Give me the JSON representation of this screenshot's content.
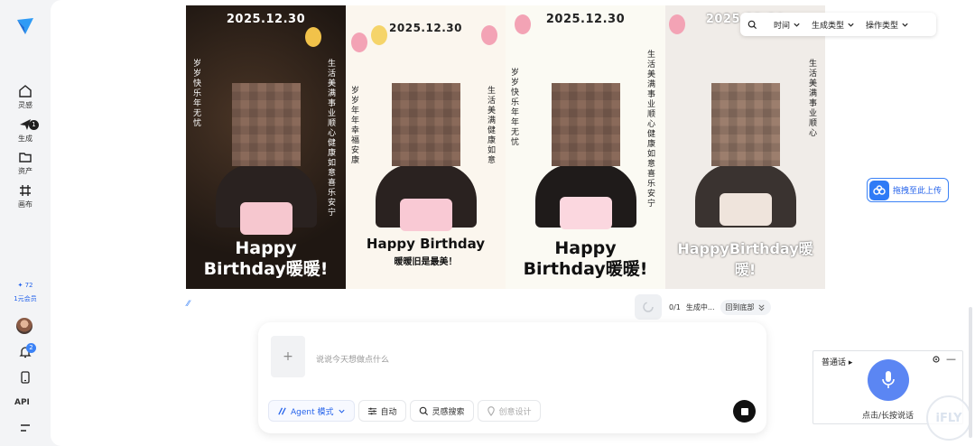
{
  "sidebar": {
    "items": [
      {
        "label": "灵感",
        "icon": "home-icon"
      },
      {
        "label": "生成",
        "icon": "generate-icon",
        "badge": "1"
      },
      {
        "label": "资产",
        "icon": "folder-icon"
      },
      {
        "label": "画布",
        "icon": "canvas-icon"
      }
    ],
    "credits": "72",
    "plan": "1元会员",
    "notification_badge": "2",
    "api_label": "API"
  },
  "gallery": [
    {
      "date": "2025.12.30",
      "greeting": "Happy Birthday暖暖!",
      "side_left": "岁岁快乐年无忧",
      "side_right": "生活美满事业顺心健康如意喜乐安宁"
    },
    {
      "date": "2025.12.30",
      "greeting": "Happy Birthday",
      "sub": "暖暖旧是最美！",
      "side_left": "岁岁年年幸福安康",
      "side_right": "生活美满健康如意"
    },
    {
      "date": "2025.12.30",
      "greeting": "Happy Birthday暖暖!",
      "side_left": "岁岁快乐年年无忧",
      "side_right": "生活美满事业顺心健康如意喜乐安宁"
    },
    {
      "date": "2025.12.30",
      "greeting": "HappyBirthday暖暖!",
      "side_right": "生活美满事业顺心"
    }
  ],
  "filters": {
    "time": "时间",
    "gen_type": "生成类型",
    "op_type": "操作类型"
  },
  "upload_label": "拖拽至此上传",
  "progress": {
    "count": "0/1",
    "status": "生成中...",
    "back": "回到底部"
  },
  "composer": {
    "placeholder": "说说今天想做点什么",
    "add": "+",
    "tools": {
      "agent": "Agent 模式",
      "auto": "自动",
      "search": "灵感搜索",
      "design": "创意设计"
    }
  },
  "voice": {
    "mode": "普通话",
    "hint": "点击/长按说话",
    "brand": "iFLY"
  },
  "colors": {
    "accent": "#2563eb",
    "mic": "#5b86f3"
  }
}
